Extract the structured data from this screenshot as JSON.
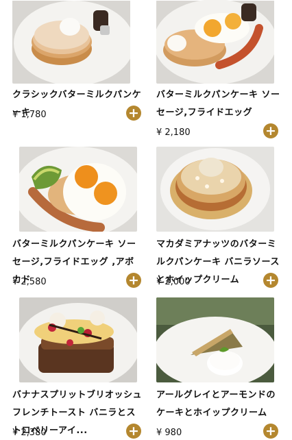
{
  "items": [
    {
      "name": "クラシックバターミルクパンケーキ",
      "price": "¥ 1,780",
      "add_icon": "plus-icon"
    },
    {
      "name": "バターミルクパンケーキ ソーセージ,フライドエッグ",
      "price": "¥ 2,180",
      "add_icon": "plus-icon"
    },
    {
      "name": "バターミルクパンケーキ ソーセージ,フライドエッグ ,アボカド",
      "price": "¥ 2,580",
      "add_icon": "plus-icon"
    },
    {
      "name": "マカダミアナッツのバターミルクパンケーキ バニラソースとホイップクリーム",
      "price": "¥ 2,000",
      "add_icon": "plus-icon"
    },
    {
      "name": "バナナスプリットブリオッシュフレンチトースト バニラとストロベリーアイ...",
      "price": "¥ 2,380",
      "add_icon": "plus-icon"
    },
    {
      "name": "アールグレイとアーモンドのケーキとホイップクリーム",
      "price": "¥ 980",
      "add_icon": "plus-icon"
    }
  ],
  "colors": {
    "accent": "#b4872f",
    "background": "#ffffff"
  }
}
